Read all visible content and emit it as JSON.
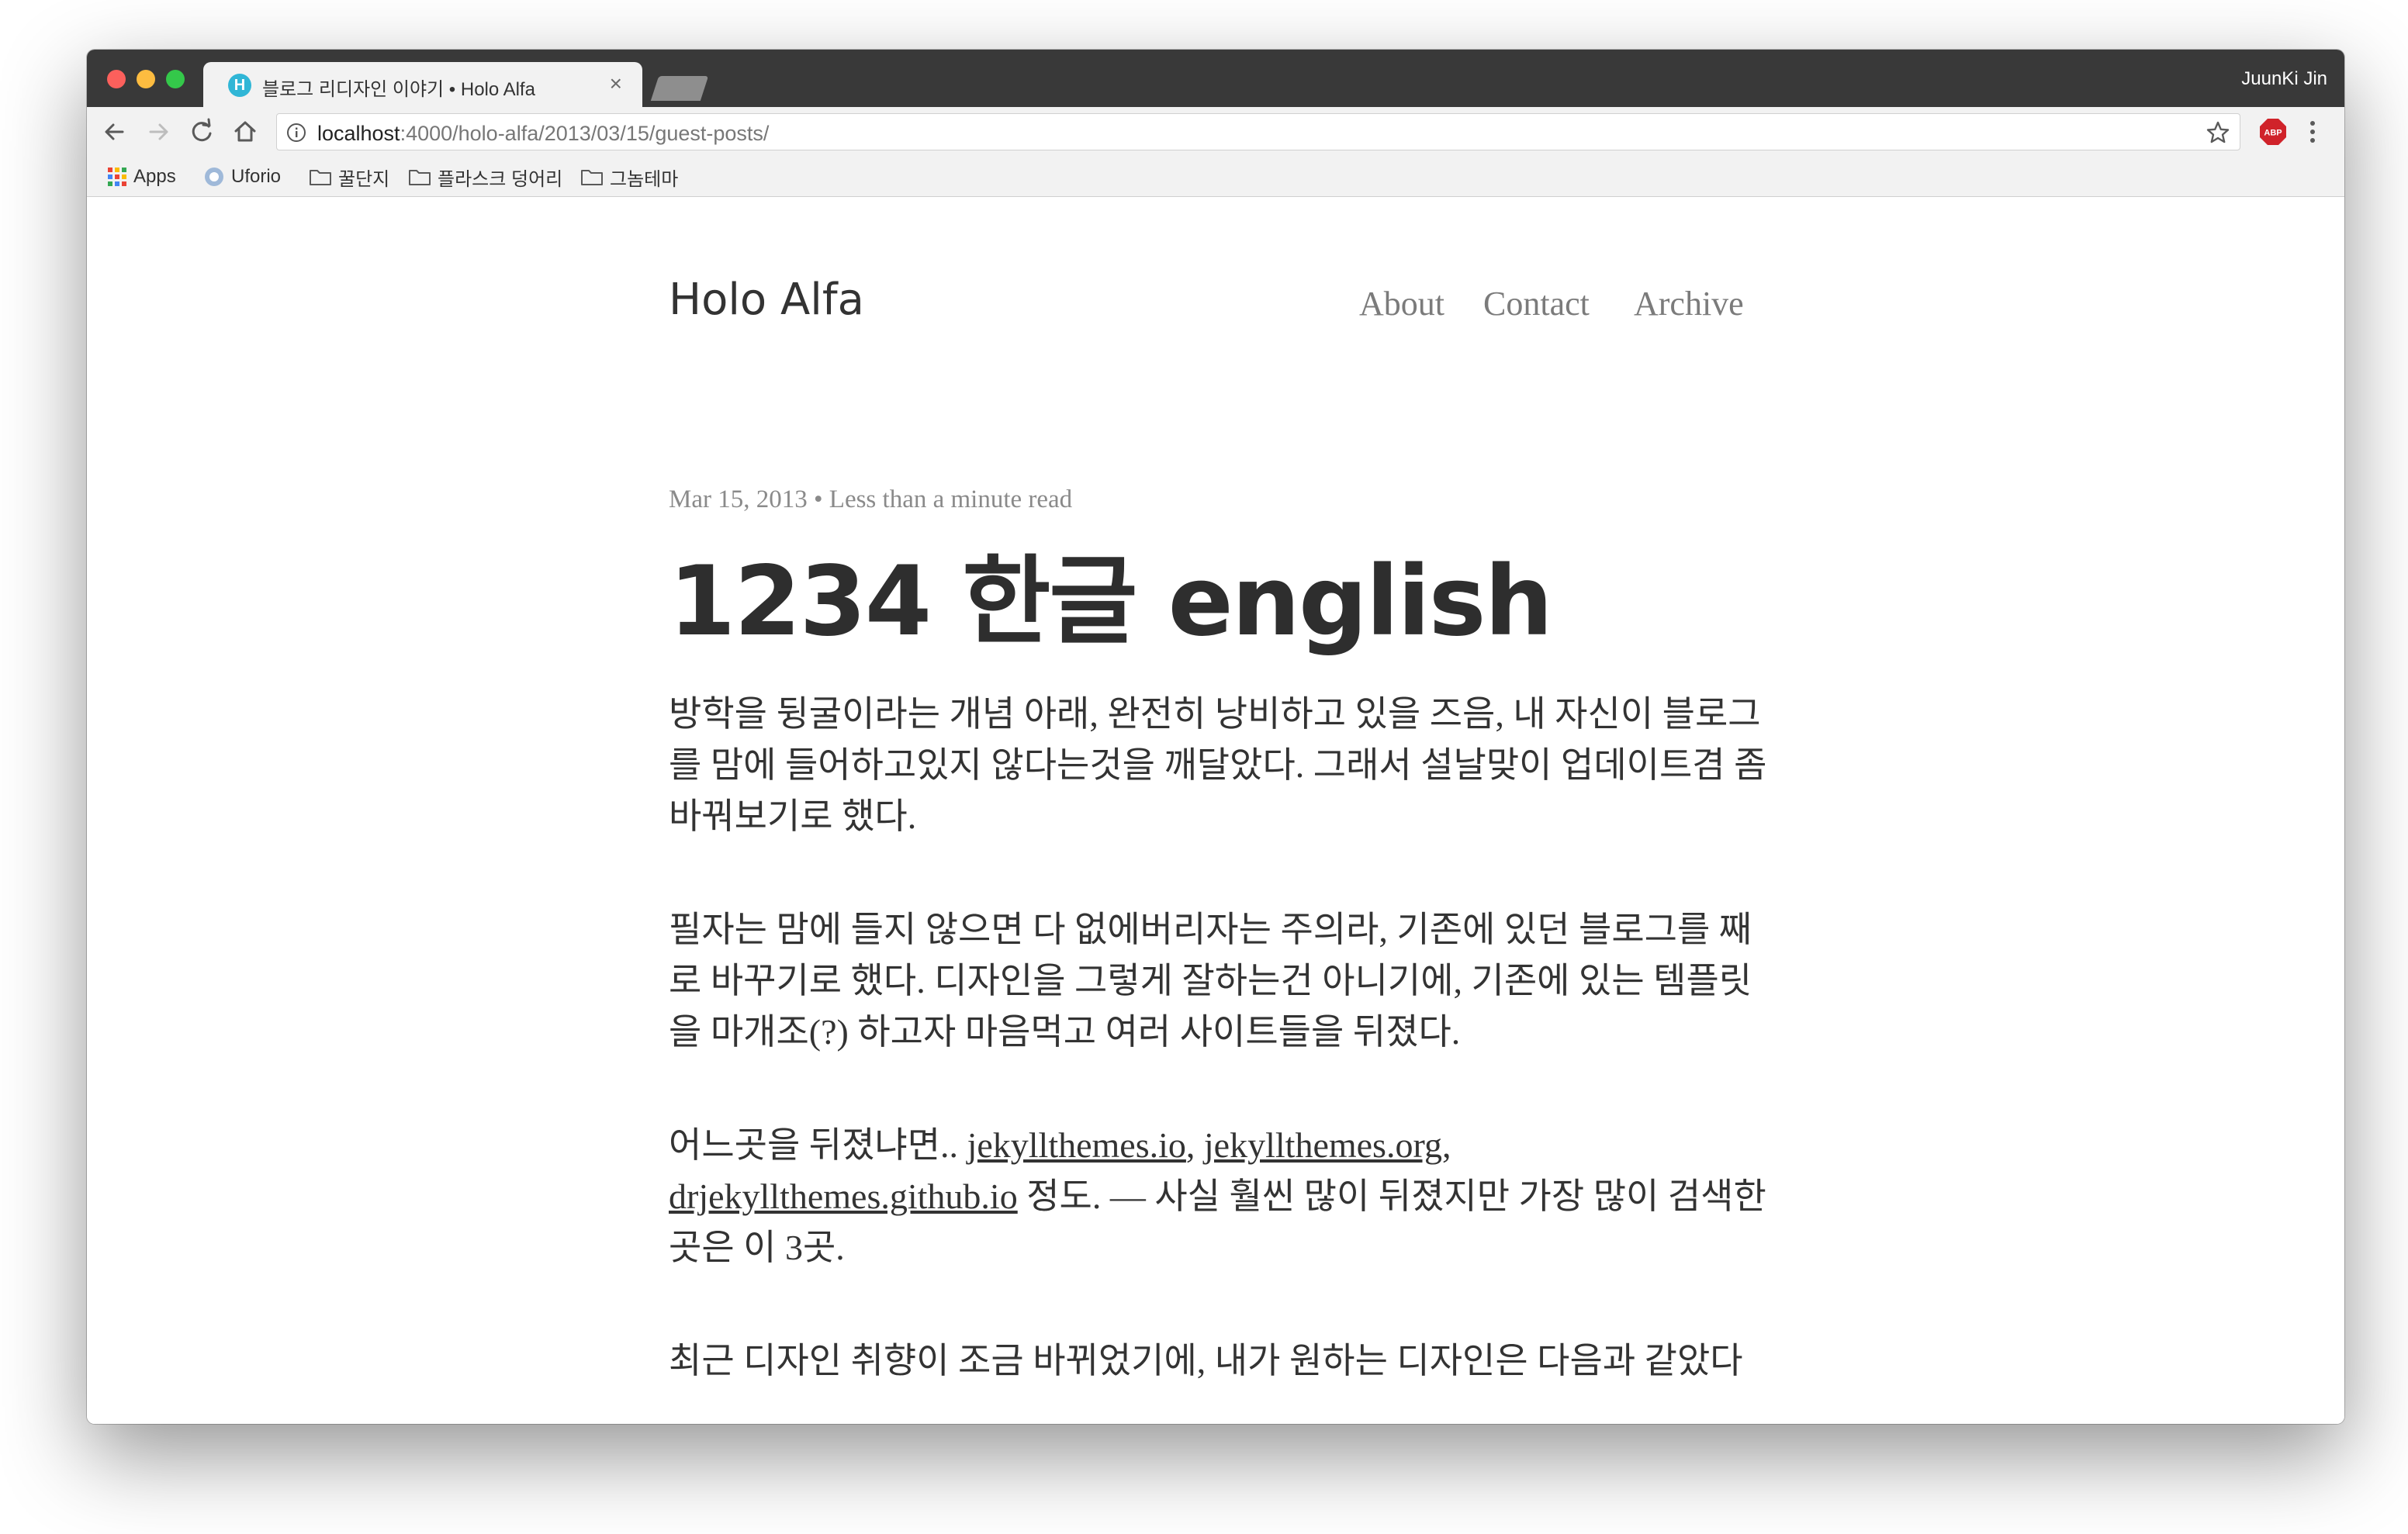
{
  "browser": {
    "tab": {
      "favicon_letter": "H",
      "title": "블로그 리디자인 이야기 • Holo Alfa",
      "close": "×"
    },
    "profile_name": "JuunKi Jin",
    "url": {
      "host": "localhost",
      "path": ":4000/holo-alfa/2013/03/15/guest-posts/"
    },
    "abp_label": "ABP",
    "bookmarks": [
      {
        "label": "Apps",
        "icon": "apps-grid-icon"
      },
      {
        "label": "Uforio",
        "icon": "uforio-icon"
      },
      {
        "label": "꿀단지",
        "icon": "folder-icon"
      },
      {
        "label": "플라스크 덩어리",
        "icon": "folder-icon"
      },
      {
        "label": "그놈테마",
        "icon": "folder-icon"
      }
    ],
    "colors": {
      "titlebar": "#393939",
      "toolbar": "#f2f2f2",
      "favicon": "#30b6d6",
      "abp_red": "#d0232a"
    }
  },
  "site": {
    "title": "Holo Alfa",
    "nav": [
      "About",
      "Contact",
      "Archive"
    ]
  },
  "post": {
    "meta": "Mar 15, 2013 • Less than a minute read",
    "title": "1234 한글 english",
    "paragraph1": "방학을 뒹굴이라는 개념 아래, 완전히 낭비하고 있을 즈음, 내 자신이 블로그를 맘에 들어하고있지 않다는것을 깨달았다. 그래서 설날맞이 업데이트겸 좀 바꿔보기로 했다.",
    "paragraph2": "필자는 맘에 들지 않으면 다 없에버리자는 주의라, 기존에 있던 블로그를 째로 바꾸기로 했다. 디자인을 그렇게 잘하는건 아니기에, 기존에 있는 템플릿을 마개조(?) 하고자 마음먹고 여러 사이트들을 뒤졌다.",
    "paragraph3": {
      "prefix": "어느곳을 뒤졌냐면.. ",
      "link1": "jekyllthemes.io",
      "sep1": ", ",
      "link2": "jekyllthemes.org",
      "sep2": ", ",
      "link3": "drjekyllthemes.github.io",
      "suffix": " 정도. — 사실 훨씬 많이 뒤졌지만 가장 많이 검색한곳은 이 3곳."
    },
    "paragraph4": "최근 디자인 취향이 조금 바뀌었기에, 내가 원하는 디자인은 다음과 같았다"
  }
}
